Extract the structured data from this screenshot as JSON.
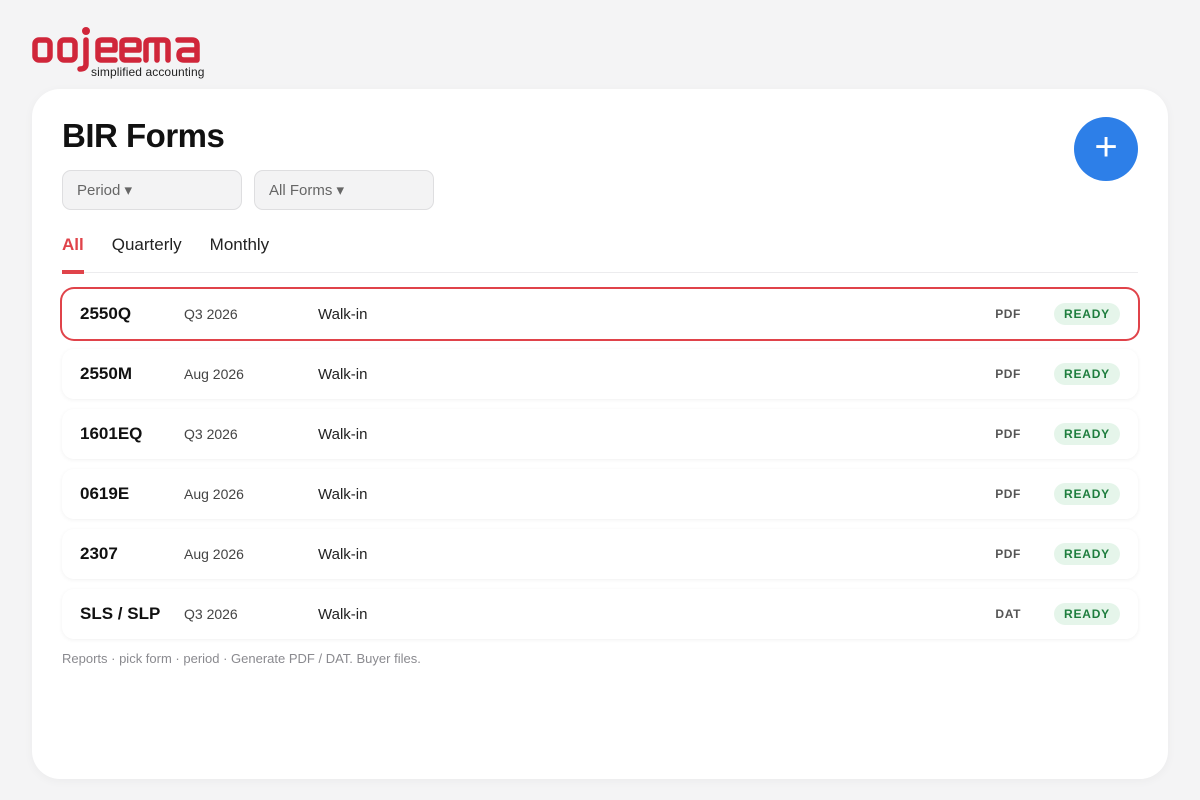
{
  "brand": {
    "name": "oojeema",
    "tagline": "simplified accounting",
    "color": "#d0263a"
  },
  "page": {
    "title": "BIR Forms",
    "add_button_label": "+"
  },
  "filters": {
    "period": "Period ▾",
    "forms": "All Forms ▾"
  },
  "tabs": [
    {
      "label": "All",
      "active": true
    },
    {
      "label": "Quarterly",
      "active": false
    },
    {
      "label": "Monthly",
      "active": false
    }
  ],
  "forms": [
    {
      "code": "2550Q",
      "period": "Q3 2026",
      "buyer": "Walk-in",
      "format": "PDF",
      "status": "READY",
      "selected": true
    },
    {
      "code": "2550M",
      "period": "Aug 2026",
      "buyer": "Walk-in",
      "format": "PDF",
      "status": "READY",
      "selected": false
    },
    {
      "code": "1601EQ",
      "period": "Q3 2026",
      "buyer": "Walk-in",
      "format": "PDF",
      "status": "READY",
      "selected": false
    },
    {
      "code": "0619E",
      "period": "Aug 2026",
      "buyer": "Walk-in",
      "format": "PDF",
      "status": "READY",
      "selected": false
    },
    {
      "code": "2307",
      "period": "Aug 2026",
      "buyer": "Walk-in",
      "format": "PDF",
      "status": "READY",
      "selected": false
    },
    {
      "code": "SLS / SLP",
      "period": "Q3 2026",
      "buyer": "Walk-in",
      "format": "DAT",
      "status": "READY",
      "selected": false
    }
  ],
  "footnote": "Reports · pick form · period · Generate PDF / DAT. Buyer files.",
  "colors": {
    "accent": "#e0434a",
    "primary": "#2d7fe8",
    "ready_bg": "#e5f5ea",
    "ready_text": "#1e7e3e"
  },
  "icons": {
    "add": "plus-icon",
    "dropdown": "caret-down-icon"
  }
}
